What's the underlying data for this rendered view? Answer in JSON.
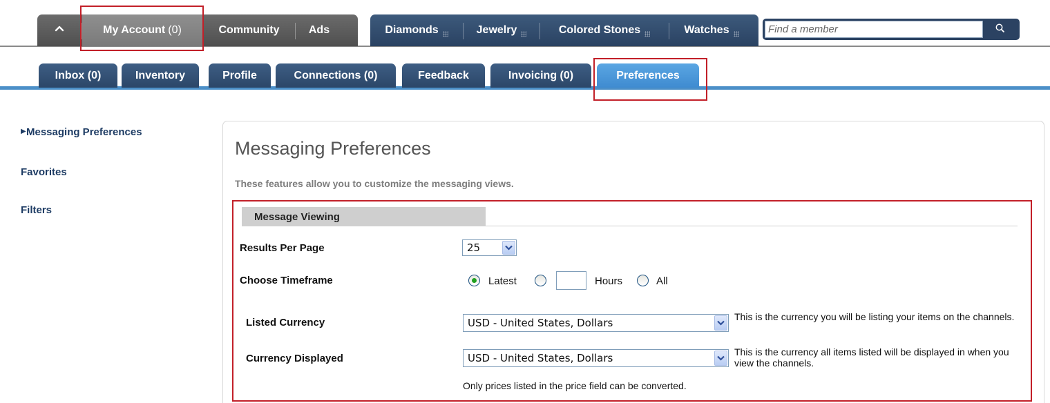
{
  "top_nav": {
    "home_icon": "home-icon",
    "gray_tabs": [
      {
        "label": "My Account",
        "count": "(0)"
      },
      {
        "label": "Community"
      },
      {
        "label": "Ads"
      }
    ],
    "blue_tabs": [
      {
        "label": "Diamonds"
      },
      {
        "label": "Jewelry"
      },
      {
        "label": "Colored Stones"
      },
      {
        "label": "Watches"
      }
    ],
    "search": {
      "placeholder": "Find a member",
      "icon": "search-icon"
    }
  },
  "sub_nav": {
    "tabs": [
      {
        "label": "Inbox (0)"
      },
      {
        "label": "Inventory"
      },
      {
        "label": "Profile"
      },
      {
        "label": "Connections (0)"
      },
      {
        "label": "Feedback"
      },
      {
        "label": "Invoicing (0)"
      },
      {
        "label": "Preferences",
        "active": true
      }
    ]
  },
  "sidebar": {
    "items": [
      {
        "label": "Messaging Preferences",
        "active": true
      },
      {
        "label": "Favorites"
      },
      {
        "label": "Filters"
      }
    ]
  },
  "main": {
    "title": "Messaging Preferences",
    "description": "These features allow you to customize the messaging views.",
    "section_title": "Message Viewing",
    "results_per_page": {
      "label": "Results Per Page",
      "value": "25"
    },
    "timeframe": {
      "label": "Choose Timeframe",
      "options": [
        "Latest",
        "Hours",
        "All"
      ],
      "selected": "Latest",
      "hours_value": ""
    },
    "listed_currency": {
      "label": "Listed Currency",
      "value": "USD - United States, Dollars",
      "hint": "This is the currency you will be listing your items on the channels."
    },
    "currency_displayed": {
      "label": "Currency Displayed",
      "value": "USD - United States, Dollars",
      "hint": "This is the currency all items listed will be displayed in when you view the channels."
    },
    "note": "Only prices listed in the price field can be converted."
  },
  "colors": {
    "highlight": "#c21f28",
    "nav_blue": "#2b4668",
    "active_tab": "#4a97d8",
    "link": "#1e3c64"
  }
}
